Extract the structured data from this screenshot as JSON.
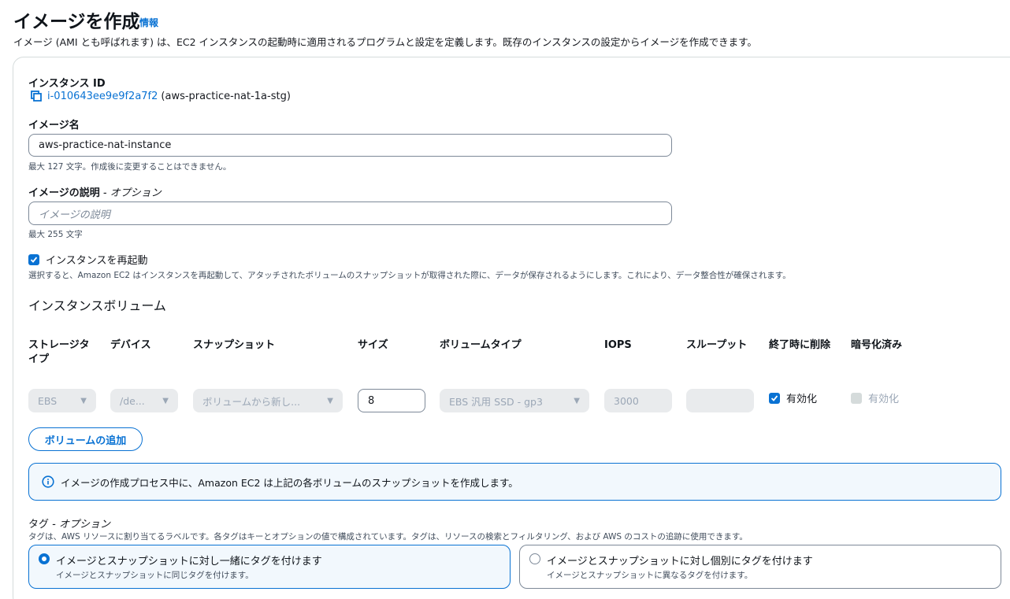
{
  "page": {
    "title": "イメージを作成",
    "info_link": "情報",
    "description": "イメージ (AMI とも呼ばれます) は、EC2 インスタンスの起動時に適用されるプログラムと設定を定義します。既存のインスタンスの設定からイメージを作成できます。"
  },
  "instance": {
    "label": "インスタンス ID",
    "id": "i-010643ee9e9f2a7f2",
    "name": "(aws-practice-nat-1a-stg)"
  },
  "image_name": {
    "label": "イメージ名",
    "value": "aws-practice-nat-instance",
    "hint": "最大 127 文字。作成後に変更することはできません。"
  },
  "image_description": {
    "label": "イメージの説明",
    "optional": "- オプション",
    "placeholder": "イメージの説明",
    "hint": "最大 255 文字"
  },
  "reboot": {
    "label": "インスタンスを再起動",
    "checked": true,
    "hint": "選択すると、Amazon EC2 はインスタンスを再起動して、アタッチされたボリュームのスナップショットが取得された際に、データが保存されるようにします。これにより、データ整合性が確保されます。"
  },
  "volumes": {
    "heading": "インスタンスボリューム",
    "columns": {
      "storage_type_1": "ストレージタ",
      "storage_type_2": "イプ",
      "device": "デバイス",
      "snapshot": "スナップショット",
      "size": "サイズ",
      "volume_type": "ボリュームタイプ",
      "iops": "IOPS",
      "throughput": "スループット",
      "delete_on_termination": "終了時に削除",
      "encrypted": "暗号化済み"
    },
    "row": {
      "storage_type": "EBS",
      "device": "/de...",
      "snapshot": "ボリュームから新し...",
      "size": "8",
      "volume_type": "EBS 汎用 SSD - gp3",
      "iops": "3000",
      "throughput": "",
      "delete_on_termination_label": "有効化",
      "encrypted_label": "有効化"
    },
    "add_button": "ボリュームの追加"
  },
  "alert": {
    "text": "イメージの作成プロセス中に、Amazon EC2 は上記の各ボリュームのスナップショットを作成します。"
  },
  "tags": {
    "label": "タグ",
    "optional": "- オプション",
    "hint": "タグは、AWS リソースに割り当てるラベルです。各タグはキーとオプションの値で構成されています。タグは、リソースの検索とフィルタリング、および AWS のコストの追跡に使用できます。",
    "options": [
      {
        "title": "イメージとスナップショットに対し一緒にタグを付けます",
        "sub": "イメージとスナップショットに同じタグを付けます。"
      },
      {
        "title": "イメージとスナップショットに対し個別にタグを付けます",
        "sub": "イメージとスナップショットに異なるタグを付けます。"
      }
    ]
  },
  "colors": {
    "accent": "#0972d3",
    "disabled_field": "#e9ebed"
  }
}
